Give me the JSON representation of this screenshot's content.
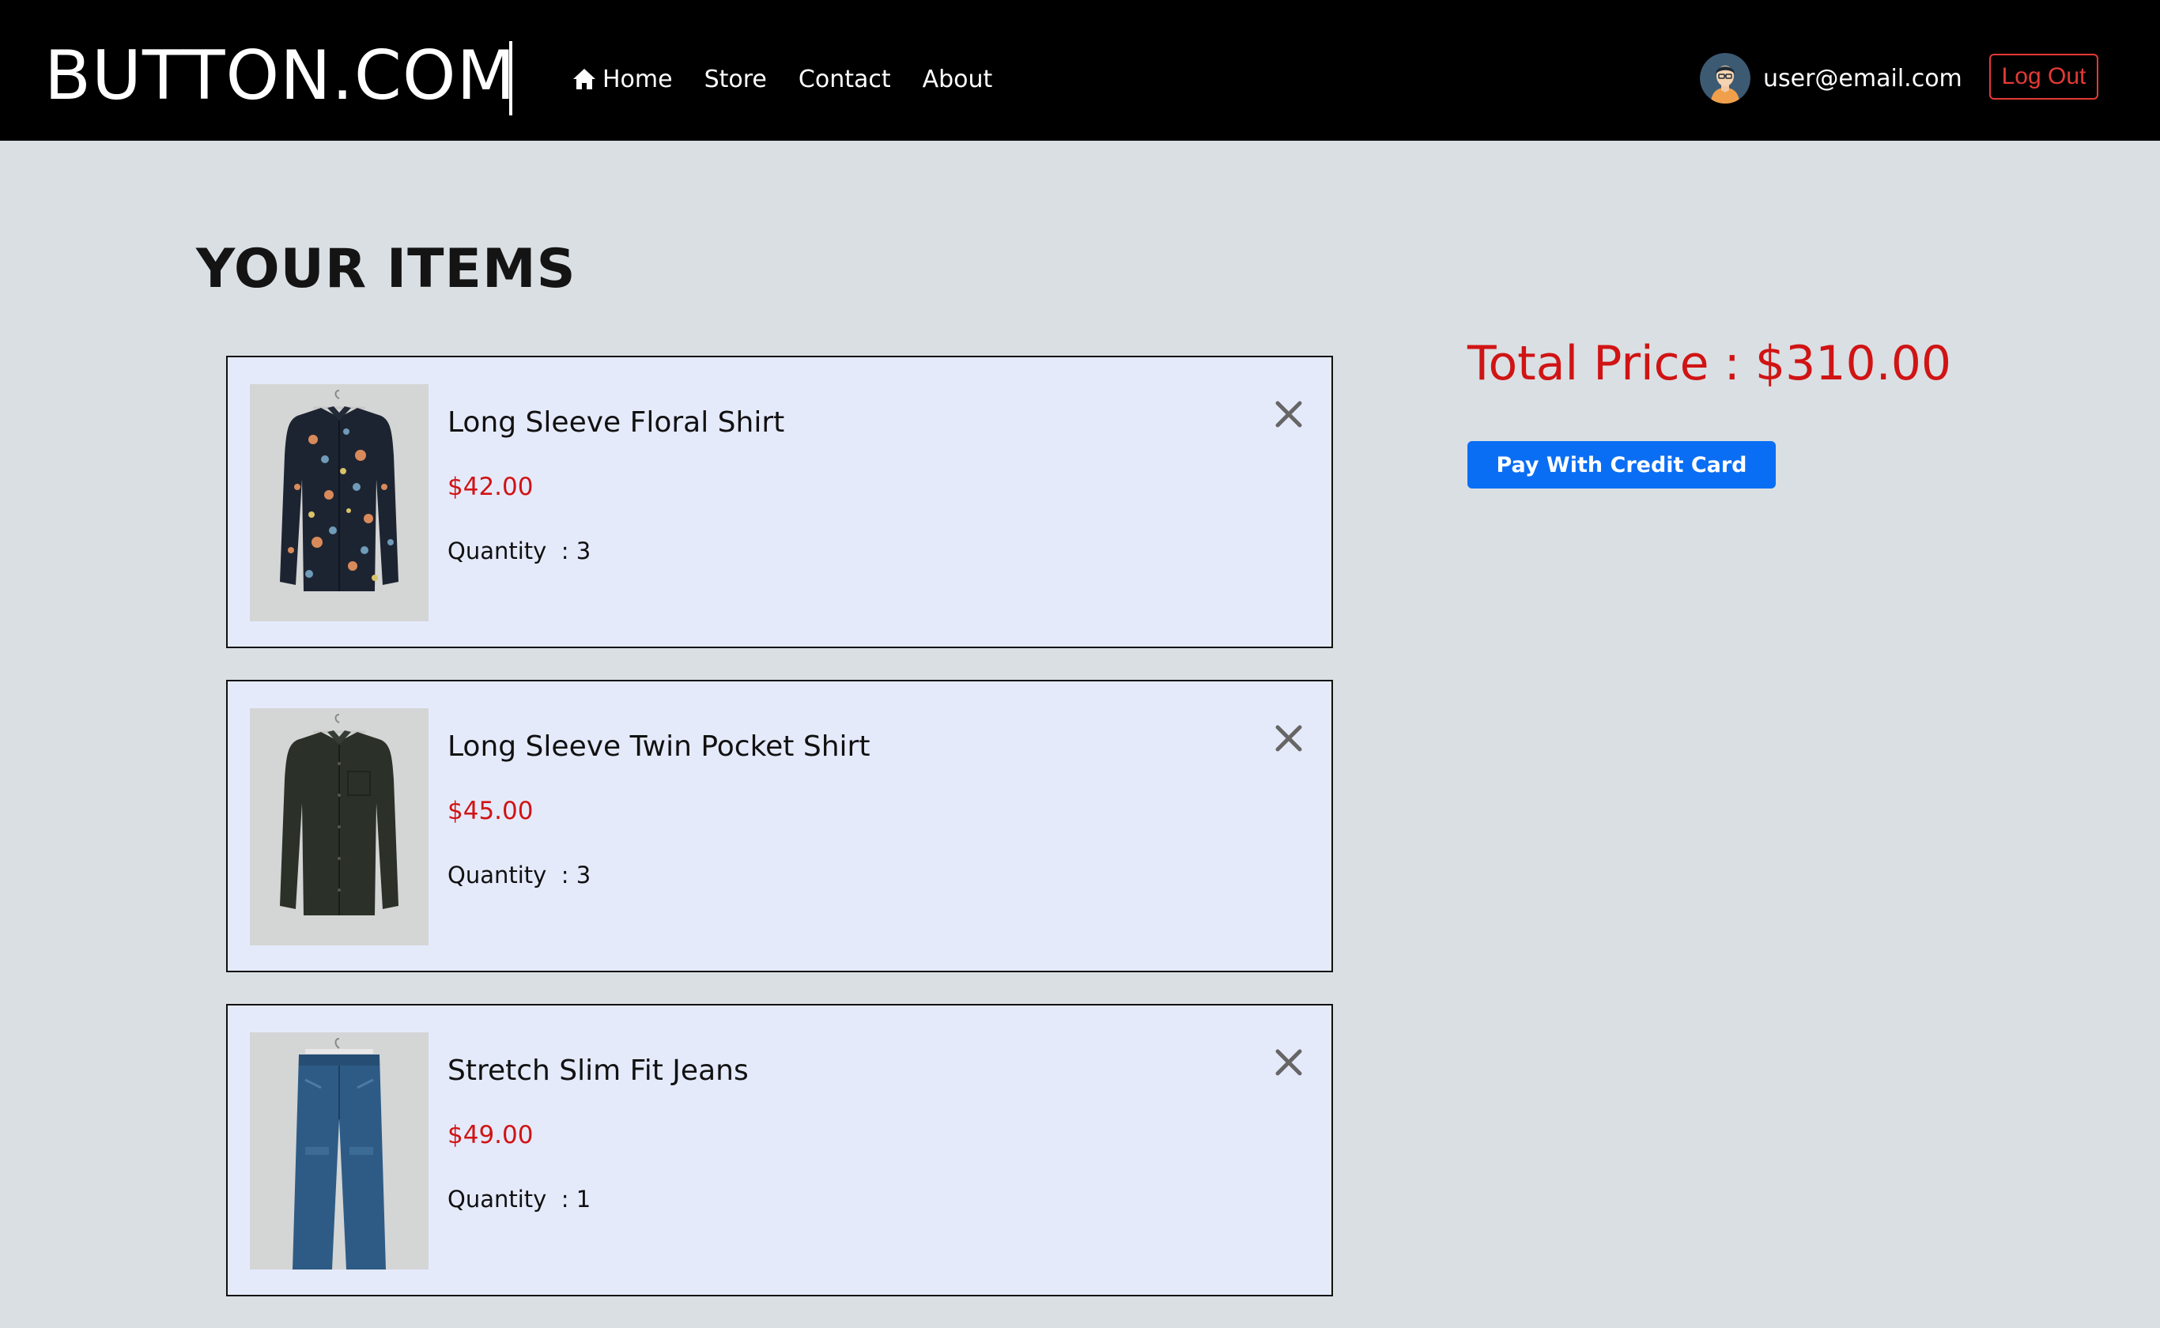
{
  "navbar": {
    "brand": "BUTTON.COM",
    "links": [
      {
        "label": "Home",
        "icon": "home-icon"
      },
      {
        "label": "Store"
      },
      {
        "label": "Contact"
      },
      {
        "label": "About"
      }
    ],
    "user_email": "user@email.com",
    "logout_label": "Log Out"
  },
  "main": {
    "title": "YOUR ITEMS",
    "items": [
      {
        "name": "Long Sleeve Floral Shirt",
        "price": "$42.00",
        "quantity_label": "Quantity",
        "quantity": ": 3",
        "image": "floral-shirt"
      },
      {
        "name": "Long Sleeve Twin Pocket Shirt",
        "price": "$45.00",
        "quantity_label": "Quantity",
        "quantity": ": 3",
        "image": "dark-green-shirt"
      },
      {
        "name": "Stretch Slim Fit Jeans",
        "price": "$49.00",
        "quantity_label": "Quantity",
        "quantity": ": 1",
        "image": "blue-jeans"
      }
    ]
  },
  "summary": {
    "total_label": "Total Price : $310.00",
    "pay_label": "Pay With Credit Card"
  },
  "colors": {
    "navbar_bg": "#000000",
    "page_bg": "#dadfe3",
    "card_bg": "#e5eafb",
    "price_red": "#d01414",
    "pay_blue": "#0a6ef5",
    "logout_red": "#e53935"
  }
}
